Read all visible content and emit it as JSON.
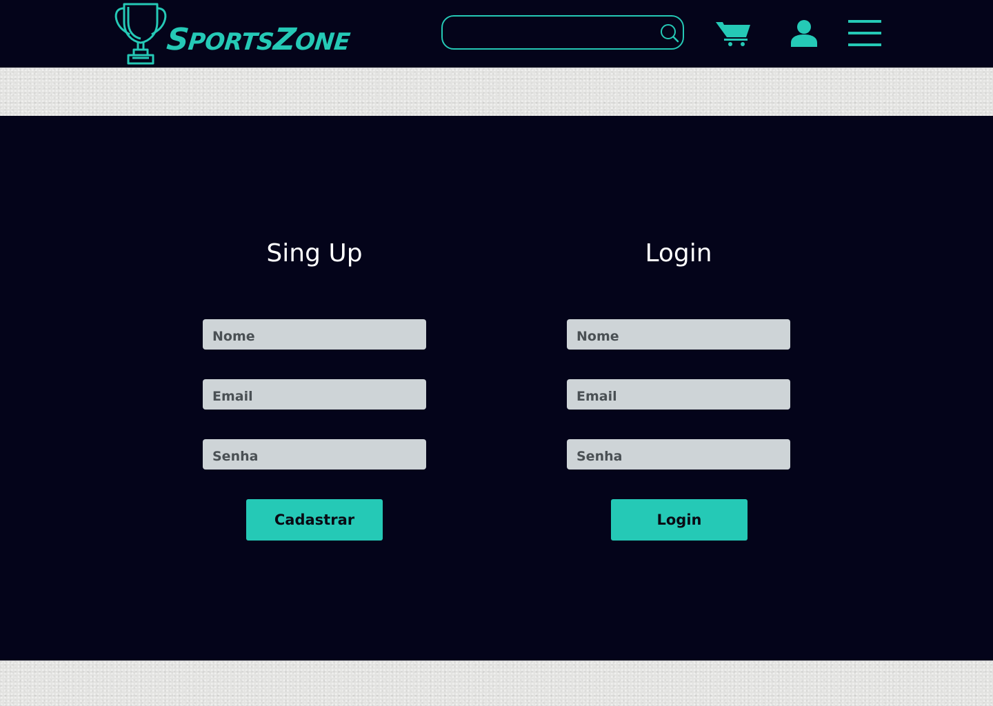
{
  "header": {
    "brand_main": "SPORTSZONE",
    "search": {
      "value": "",
      "placeholder": ""
    },
    "icons": [
      "trophy-logo-icon",
      "search-icon",
      "cart-icon",
      "user-icon",
      "menu-icon"
    ]
  },
  "signup": {
    "title": "Sing Up",
    "fields": [
      {
        "placeholder": "Nome"
      },
      {
        "placeholder": "Email"
      },
      {
        "placeholder": "Senha"
      }
    ],
    "button_label": "Cadastrar"
  },
  "login": {
    "title": "Login",
    "fields": [
      {
        "placeholder": "Nome"
      },
      {
        "placeholder": "Email"
      },
      {
        "placeholder": "Senha"
      }
    ],
    "button_label": "Login"
  },
  "colors": {
    "background": "#04041a",
    "accent": "#25c9b6",
    "field": "#ced4d7",
    "paper": "#e3e3e1"
  }
}
